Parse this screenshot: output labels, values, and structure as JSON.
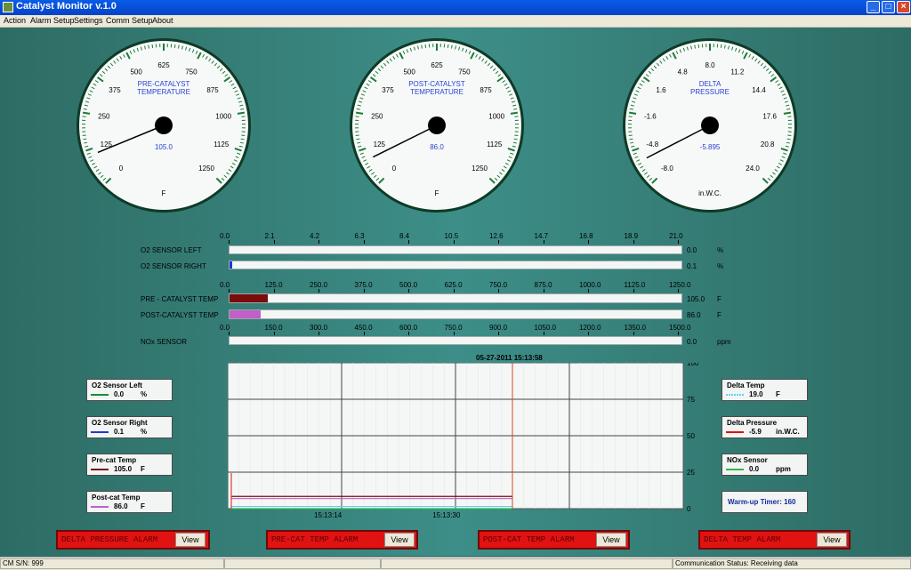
{
  "window": {
    "title": "Catalyst Monitor v.1.0"
  },
  "menu": [
    "Action",
    "Alarm Setup",
    "Settings",
    "Comm Setup",
    "About"
  ],
  "gauges": [
    {
      "title1": "PRE-CATALYST",
      "title2": "TEMPERATURE",
      "value": "105.0",
      "unit": "F",
      "ticks": [
        "0",
        "125",
        "250",
        "375",
        "500",
        "625",
        "750",
        "875",
        "1000",
        "1125",
        "1250"
      ],
      "min": 0,
      "max": 1250,
      "reading": 105.0
    },
    {
      "title1": "POST-CATALYST",
      "title2": "TEMPERATURE",
      "value": "86.0",
      "unit": "F",
      "ticks": [
        "0",
        "125",
        "250",
        "375",
        "500",
        "625",
        "750",
        "875",
        "1000",
        "1125",
        "1250"
      ],
      "min": 0,
      "max": 1250,
      "reading": 86.0
    },
    {
      "title1": "DELTA",
      "title2": "PRESSURE",
      "value": "-5.895",
      "unit": "in.W.C.",
      "ticks": [
        "-8.0",
        "-4.8",
        "-1.6",
        "1.6",
        "4.8",
        "8.0",
        "11.2",
        "14.4",
        "17.6",
        "20.8",
        "24.0"
      ],
      "min": -8.0,
      "max": 24.0,
      "reading": -5.895
    }
  ],
  "bars": {
    "o2_scale": [
      "0.0",
      "2.1",
      "4.2",
      "6.3",
      "8.4",
      "10.5",
      "12.6",
      "14.7",
      "16.8",
      "18.9",
      "21.0"
    ],
    "temp_scale": [
      "0.0",
      "125.0",
      "250.0",
      "375.0",
      "500.0",
      "625.0",
      "750.0",
      "875.0",
      "1000.0",
      "1125.0",
      "1250.0"
    ],
    "nox_scale": [
      "0.0",
      "150.0",
      "300.0",
      "450.0",
      "600.0",
      "750.0",
      "900.0",
      "1050.0",
      "1200.0",
      "1350.0",
      "1500.0"
    ],
    "o2_left": {
      "label": "O2 SENSOR LEFT",
      "value": "0.0",
      "unit": "%",
      "fraction": 0.0,
      "color": "#1a3ad0"
    },
    "o2_right": {
      "label": "O2 SENSOR RIGHT",
      "value": "0.1",
      "unit": "%",
      "fraction": 0.005,
      "color": "#1a3ad0"
    },
    "pre_cat": {
      "label": "PRE - CATALYST TEMP",
      "value": "105.0",
      "unit": "F",
      "fraction": 0.084,
      "color": "#7a0c0c"
    },
    "post_cat": {
      "label": "POST-CATALYST TEMP",
      "value": "86.0",
      "unit": "F",
      "fraction": 0.069,
      "color": "#c060c8"
    },
    "nox": {
      "label": "NOx SENSOR",
      "value": "0.0",
      "unit": "ppm",
      "fraction": 0.0,
      "color": "#2fb84a"
    }
  },
  "chart_data": {
    "type": "line",
    "title": "05-27-2011  15:13:58",
    "x_ticks": [
      "15:13:14",
      "15:13:30"
    ],
    "y_ticks": [
      "0",
      "25",
      "50",
      "75",
      "100"
    ],
    "ylim": [
      0,
      100
    ],
    "grid": true,
    "series": [
      {
        "name": "Pre-cat Temp",
        "color": "#7a0c0c",
        "values": [
          8.4,
          8.4,
          8.4,
          8.4,
          8.4
        ]
      },
      {
        "name": "Post-cat Temp",
        "color": "#c060c8",
        "values": [
          6.9,
          6.9,
          6.9,
          6.9,
          6.9
        ]
      },
      {
        "name": "Delta Temp",
        "color": "#66ccee",
        "values": [
          1.5,
          1.5,
          1.5,
          1.5,
          1.5
        ]
      },
      {
        "name": "NOx Sensor",
        "color": "#2fb84a",
        "values": [
          0,
          0,
          0,
          0,
          0
        ]
      }
    ]
  },
  "legend_left": [
    {
      "title": "O2 Sensor Left",
      "value": "0.0",
      "unit": "%",
      "color": "#1f8a3a"
    },
    {
      "title": "O2 Sensor Right",
      "value": "0.1",
      "unit": "%",
      "color": "#1a3ad0"
    },
    {
      "title": "Pre-cat Temp",
      "value": "105.0",
      "unit": "F",
      "color": "#7a0c0c"
    },
    {
      "title": "Post-cat Temp",
      "value": "86.0",
      "unit": "F",
      "color": "#c060c8"
    }
  ],
  "legend_right": [
    {
      "title": "Delta Temp",
      "value": "19.0",
      "unit": "F",
      "color": "#66ccee"
    },
    {
      "title": "Delta Pressure",
      "value": "-5.9",
      "unit": "in.W.C.",
      "color": "#e01010"
    },
    {
      "title": "NOx Sensor",
      "value": "0.0",
      "unit": "ppm",
      "color": "#2fb84a"
    }
  ],
  "warmup": {
    "label": "Warm-up Timer: 160"
  },
  "alarms": [
    {
      "label": "DELTA PRESSURE ALARM",
      "button": "View"
    },
    {
      "label": "PRE-CAT TEMP ALARM",
      "button": "View"
    },
    {
      "label": "POST-CAT TEMP ALARM",
      "button": "View"
    },
    {
      "label": "DELTA TEMP ALARM",
      "button": "View"
    }
  ],
  "status": {
    "serial": "CM S/N: 999",
    "comm": "Communication Status: Receiving data"
  }
}
